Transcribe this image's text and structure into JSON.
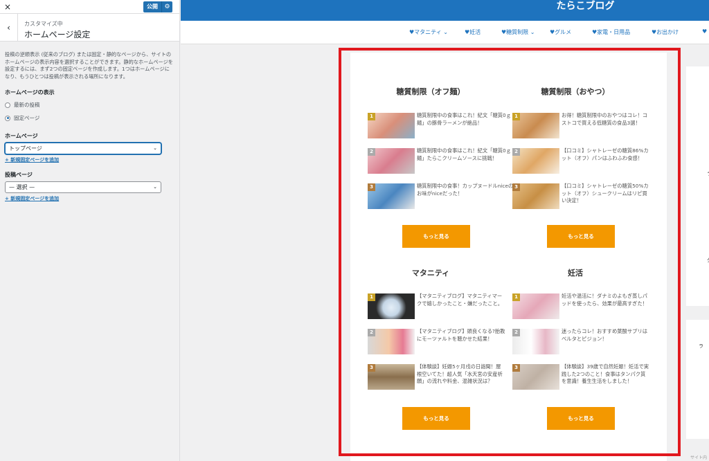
{
  "customizer": {
    "close_label": "×",
    "publish_label": "公開",
    "gear_glyph": "⚙",
    "back_glyph": "‹",
    "breadcrumb": "カスタマイズ中",
    "section_title": "ホームページ設定",
    "description": "投稿の逆順表示 (従来のブログ) または固定・静的なページから、サイトのホームページの表示内容を選択することができます。静的なホームページを設定するには、まず2つの固定ページを作成します。1つはホームページになり、もうひとつは投稿が表示される場所になります。",
    "homepage_display_label": "ホームページの表示",
    "radio_latest_posts": "最新の投稿",
    "radio_static_page": "固定ページ",
    "homepage_label": "ホームページ",
    "homepage_select_value": "トップページ",
    "add_page_link_1": "+ 新規固定ページを追加",
    "posts_page_label": "投稿ページ",
    "posts_select_value": "— 選択 —",
    "add_page_link_2": "+ 新規固定ページを追加",
    "chevron_glyph": "⌄"
  },
  "site": {
    "title": "たらこブログ",
    "nav": [
      {
        "label": "♥マタニティ ⌄"
      },
      {
        "label": "♥妊活"
      },
      {
        "label": "♥糖質制限 ⌄"
      },
      {
        "label": "♥グルメ"
      },
      {
        "label": "♥家電・日用品"
      },
      {
        "label": "♥お出かけ"
      },
      {
        "label": "♥"
      }
    ]
  },
  "sections": [
    {
      "title": "糖質制限（オフ麺）",
      "more_label": "もっと見る",
      "entries": [
        {
          "rank": "1",
          "text": "糖質制限中の食事はこれ！紀文「糖質0ｇ麺」の豚骨ラーメンが絶品！"
        },
        {
          "rank": "2",
          "text": "糖質制限中の食事はこれ！紀文「糖質0ｇ麺」たらこクリームソースに挑戦！"
        },
        {
          "rank": "3",
          "text": "糖質制限中の食事！カップヌードルniceのお味がniceだった！"
        }
      ]
    },
    {
      "title": "糖質制限（おやつ）",
      "more_label": "もっと見る",
      "entries": [
        {
          "rank": "1",
          "text": "お得！糖質制限中のおやつはコレ！コストコで買える低糖質の食品3選！"
        },
        {
          "rank": "2",
          "text": "【口コミ】シャトレーゼの糖質86%カット（オフ）パンはふわふわ食感！"
        },
        {
          "rank": "3",
          "text": "【口コミ】シャトレーゼの糖質50%カット（オフ）シュークリームはリピ買い決定！"
        }
      ]
    },
    {
      "title": "マタニティ",
      "more_label": "もっと見る",
      "entries": [
        {
          "rank": "1",
          "text": "【マタニティブログ】マタニティマークで嬉しかったこと・嫌だったこと。"
        },
        {
          "rank": "2",
          "text": "【マタニティブログ】頭良くなる?胎教にモーツァルトを聴かせた結果！"
        },
        {
          "rank": "3",
          "text": "【体験談】妊娠5ヶ月戌の日詣聞！屋根空いてた！超人気「水天宮の安産祈願」の流れや料金、混雑状況は？"
        }
      ]
    },
    {
      "title": "妊活",
      "more_label": "もっと見る",
      "entries": [
        {
          "rank": "1",
          "text": "妊活や温活に！ダナミのよもぎ蒸しパッドを使ったら、効果が最高すぎた！"
        },
        {
          "rank": "2",
          "text": "迷ったらコレ！おすすめ葉酸サプリはベルタとピジョン！"
        },
        {
          "rank": "3",
          "text": "【体験談】39歳で自然妊娠！妊活で実践した2つのこと！食事はタンパク質を意識！養生生活をしました！"
        }
      ]
    }
  ],
  "right_edge": {
    "marks": [
      "ラ",
      "ダ",
      "ラ"
    ],
    "footer": "サイト内"
  },
  "colors": {
    "wp_blue": "#2271b1",
    "header_blue": "#1e73be",
    "more_button": "#f39800",
    "highlight_frame": "#e1181e"
  }
}
